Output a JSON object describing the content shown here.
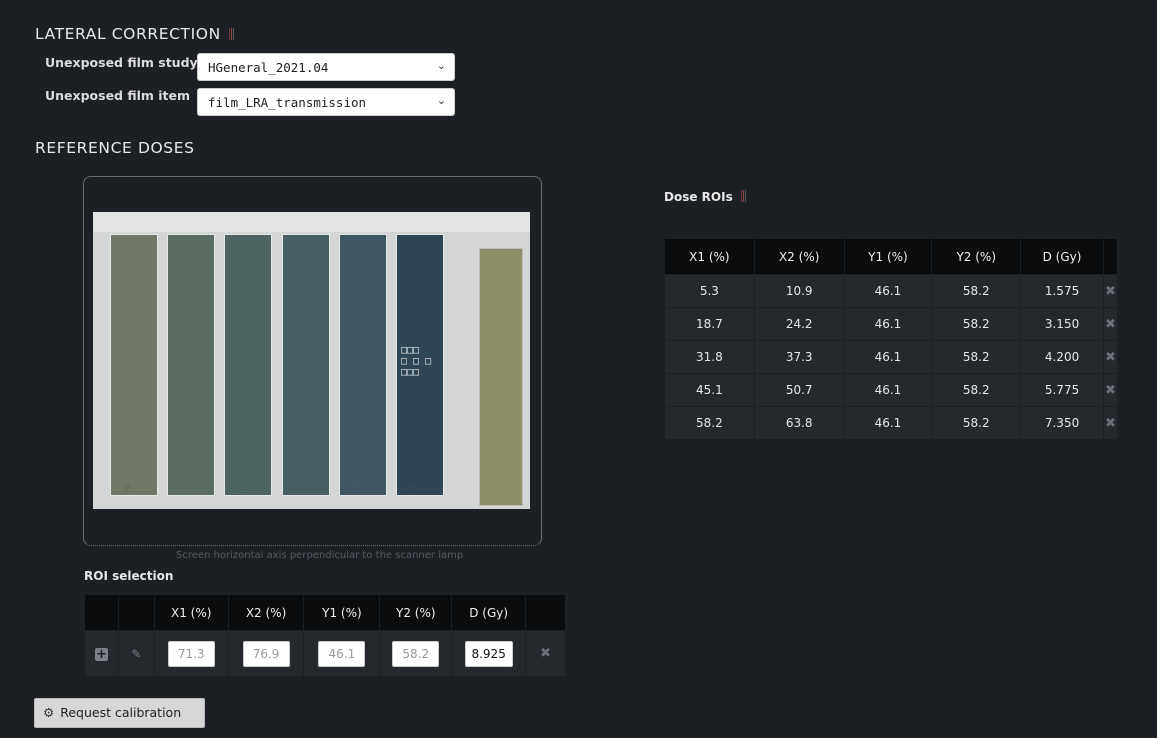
{
  "lateral": {
    "title": "LATERAL CORRECTION",
    "study_label": "Unexposed film study",
    "study_value": "HGeneral_2021.04",
    "item_label": "Unexposed film item",
    "item_value": "film_LRA_transmission"
  },
  "reference": {
    "title": "REFERENCE DOSES",
    "caption": "Screen horizontal axis perpendicular to the scanner lamp",
    "film_strip_colors": [
      "#6e7865",
      "#5c6e64",
      "#4f6462",
      "#475e62",
      "#3e5761",
      "#2f4754"
    ],
    "reference_strip_color": "#8e8f66",
    "roi_handles": "□□□\n□ □ □\n□□□"
  },
  "columns": [
    "X1 (%)",
    "X2 (%)",
    "Y1 (%)",
    "Y2 (%)",
    "D (Gy)"
  ],
  "dose_rois": {
    "title": "Dose ROIs",
    "rows": [
      [
        "5.3",
        "10.9",
        "46.1",
        "58.2",
        "1.575"
      ],
      [
        "18.7",
        "24.2",
        "46.1",
        "58.2",
        "3.150"
      ],
      [
        "31.8",
        "37.3",
        "46.1",
        "58.2",
        "4.200"
      ],
      [
        "45.1",
        "50.7",
        "46.1",
        "58.2",
        "5.775"
      ],
      [
        "58.2",
        "63.8",
        "46.1",
        "58.2",
        "7.350"
      ]
    ]
  },
  "roi_selection": {
    "title": "ROI selection",
    "values": [
      "71.3",
      "76.9",
      "46.1",
      "58.2",
      "8.925"
    ]
  },
  "icons": {
    "delete": "✖",
    "add": "+",
    "edit": "✎",
    "dropdown": "⌄",
    "gear": "⚙"
  },
  "request_calibration_label": "Request calibration"
}
